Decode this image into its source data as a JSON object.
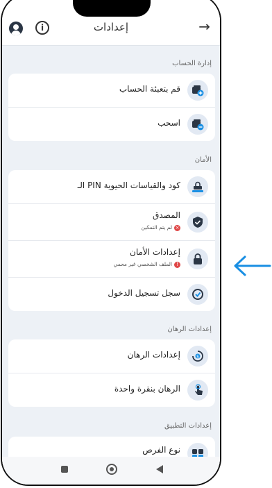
{
  "header": {
    "title": "إعدادات",
    "back_icon": "arrow-right-icon",
    "info_label": "i"
  },
  "sections": [
    {
      "title": "إدارة الحساب",
      "items": [
        {
          "label": "قم بتعبئة الحساب",
          "icon": "wallet-add-icon"
        },
        {
          "label": "اسحب",
          "icon": "wallet-remove-icon"
        }
      ]
    },
    {
      "title": "الأمان",
      "items": [
        {
          "label": "كود والقياسات الحيوية PIN الـ",
          "icon": "pin-lock-icon"
        },
        {
          "label": "المصدق",
          "sub": "لم يتم التمكين",
          "sub_status": "error",
          "icon": "shield-check-icon"
        },
        {
          "label": "إعدادات الأمان",
          "sub": "الملف الشخصي غير محمي",
          "sub_status": "warning",
          "icon": "lock-icon"
        },
        {
          "label": "سجل تسجيل الدخول",
          "icon": "history-icon"
        }
      ]
    },
    {
      "title": "إعدادات الرهان",
      "items": [
        {
          "label": "إعدادات الرهان",
          "icon": "coin-settings-icon"
        },
        {
          "label": "الرهان بنقرة واحدة",
          "icon": "tap-icon"
        }
      ]
    },
    {
      "title": "إعدادات التطبيق",
      "items": [
        {
          "label": "نوع الفرص",
          "icon": "odds-type-icon"
        }
      ]
    }
  ],
  "colors": {
    "accent": "#1a8fe3",
    "icon_bg": "#e2e9f3",
    "page_bg": "#edf1f6",
    "error": "#e04848"
  },
  "annotation": {
    "icon": "arrow-left-icon",
    "color": "#1a8fe3"
  }
}
